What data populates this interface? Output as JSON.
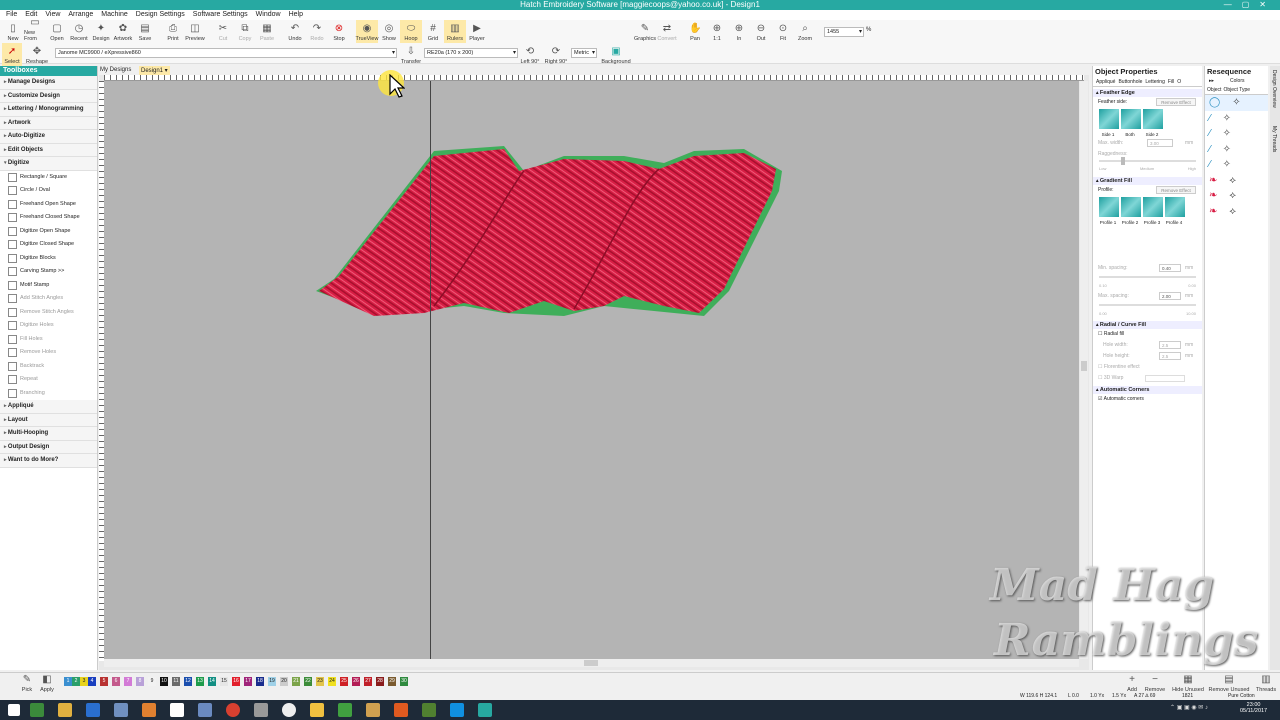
{
  "titlebar": {
    "title": "Hatch Embroidery Software [maggiecoops@yahoo.co.uk] - Design1"
  },
  "menu": [
    "File",
    "Edit",
    "View",
    "Arrange",
    "Machine",
    "Design Settings",
    "Software Settings",
    "Window",
    "Help"
  ],
  "toolbar": [
    "New",
    "New From",
    "Open",
    "Recent",
    "Design",
    "Artwork",
    "Save",
    "Print",
    "Preview",
    "Cut",
    "Copy",
    "Paste",
    "Undo",
    "Redo",
    "Stop",
    "TrueView",
    "Show",
    "Hoop",
    "Grid",
    "Rulers",
    "Player",
    "Graphics",
    "Convert",
    "Pan",
    "1:1",
    "In",
    "Out",
    "Fit",
    "Zoom"
  ],
  "zoom_value": "1455",
  "zoom_unit": "%",
  "toolbar2": {
    "select": "Select",
    "reshape": "Reshape",
    "machine": "Janome MC9900 / eXpressive860",
    "transfer": "Transfer",
    "hoop": "RE20a (170 x 200)",
    "left90": "Left 90°",
    "right90": "Right 90°",
    "units": "Metric",
    "background": "Background"
  },
  "toolboxes": {
    "title": "Toolboxes",
    "sections_top": [
      "Manage Designs",
      "Customize Design",
      "Lettering / Monogramming",
      "Artwork",
      "Auto-Digitize",
      "Edit Objects",
      "Digitize"
    ],
    "digitize_items": [
      "Rectangle / Square",
      "Circle / Oval",
      "Freehand Open Shape",
      "Freehand Closed Shape",
      "Digitize Open Shape",
      "Digitize Closed Shape",
      "Digitize Blocks",
      "Carving Stamp >>",
      "Motif Stamp",
      "Add Stitch Angles",
      "Remove Stitch Angles",
      "Digitize Holes",
      "Fill Holes",
      "Remove Holes",
      "Backtrack",
      "Repeat",
      "Branching"
    ],
    "sections_bottom": [
      "Appliqué",
      "Layout",
      "Multi-Hooping",
      "Output Design",
      "Want to do More?"
    ]
  },
  "tabs": {
    "mydesigns": "My Designs",
    "design1": "Design1"
  },
  "objprops": {
    "title": "Object Properties",
    "tabs": [
      "Appliqué",
      "Buttonhole",
      "Lettering",
      "Fill",
      "O"
    ],
    "feather_edge": "Feather Edge",
    "feather_side": "Feather side:",
    "remove_effect": "Remove Effect",
    "sides": [
      "Side 1",
      "Both",
      "Side 2"
    ],
    "max_width": "Max. width:",
    "max_width_val": "3.00",
    "raggedness": "Raggedness:",
    "rag_labels": [
      "Low",
      "Medium",
      "High"
    ],
    "gradient_fill": "Gradient Fill",
    "profile": "Profile:",
    "profiles": [
      "Profile 1",
      "Profile 2",
      "Profile 3",
      "Profile 4"
    ],
    "min_spacing": "Min. spacing:",
    "min_spacing_val": "0.40",
    "max_spacing": "Max. spacing:",
    "max_spacing_val": "2.00",
    "scale_a": [
      "0.10",
      "0.00"
    ],
    "scale_b": [
      "0.00",
      "10.00"
    ],
    "radial": "Radial / Curve Fill",
    "radial_fill": "Radial fill",
    "hole_width": "Hole width:",
    "hole_width_val": "2.5",
    "hole_height": "Hole height:",
    "hole_height_val": "2.5",
    "florentine": "Florentine effect",
    "warp": "3D Warp",
    "auto_corners": "Automatic Corners",
    "auto_corners_chk": "Automatic corners",
    "unit": "mm"
  },
  "resequence": {
    "title": "Resequence",
    "colors": "Colors",
    "object_type": "Object",
    "object_type2": "Object Type"
  },
  "sidetabs": [
    "Design Overview",
    "My Threads"
  ],
  "colorbar": {
    "pick": "Pick",
    "apply": "Apply",
    "add": "Add",
    "remove": "Remove",
    "hide_unused": "Hide Unused",
    "remove_unused": "Remove Unused",
    "threads": "Threads",
    "chips": [
      {
        "n": "1",
        "c": "#3a8fd0"
      },
      {
        "n": "2",
        "c": "#2a9f6a"
      },
      {
        "n": "3",
        "c": "#e8d21c"
      },
      {
        "n": "4",
        "c": "#1a3fbf"
      },
      {
        "n": "5",
        "c": "#b83232"
      },
      {
        "n": "6",
        "c": "#c45a8c"
      },
      {
        "n": "7",
        "c": "#d37bd6"
      },
      {
        "n": "8",
        "c": "#b9a1d8"
      },
      {
        "n": "9",
        "c": "#f2f2f2"
      },
      {
        "n": "10",
        "c": "#111111"
      },
      {
        "n": "11",
        "c": "#6b6b6b"
      },
      {
        "n": "12",
        "c": "#1b4fae"
      },
      {
        "n": "13",
        "c": "#1f9c4c"
      },
      {
        "n": "14",
        "c": "#138f83"
      },
      {
        "n": "15",
        "c": "#e6e6e6"
      },
      {
        "n": "16",
        "c": "#e21f2c"
      },
      {
        "n": "17",
        "c": "#a0247a"
      },
      {
        "n": "18",
        "c": "#1a2d8e"
      },
      {
        "n": "19",
        "c": "#9fd1e8"
      },
      {
        "n": "20",
        "c": "#cccccc"
      },
      {
        "n": "21",
        "c": "#7ca44a"
      },
      {
        "n": "22",
        "c": "#3d8d3a"
      },
      {
        "n": "23",
        "c": "#e2c54b"
      },
      {
        "n": "24",
        "c": "#f0e020"
      },
      {
        "n": "25",
        "c": "#cf2025"
      },
      {
        "n": "26",
        "c": "#b31d55"
      },
      {
        "n": "27",
        "c": "#c0202a"
      },
      {
        "n": "28",
        "c": "#8a1c1c"
      },
      {
        "n": "29",
        "c": "#7a5a2e"
      },
      {
        "n": "30",
        "c": "#2e8a3e"
      }
    ]
  },
  "status": {
    "coords": "W 119.6 H 124.1",
    "length": "L 0.0",
    "stitches": "1.0 Yx",
    "extra": "1.5 Yx",
    "angle": "A 27 ∆ 69",
    "count": "1821",
    "thread": "Pure Cotton"
  },
  "clock": {
    "time": "23:00",
    "date": "05/11/2017"
  },
  "watermark": {
    "line1": "Mad Hag",
    "line2": "Ramblings"
  },
  "colors": {
    "accent": "#27a9a2",
    "canvas": "#b4b4b4",
    "red": "#d81e45",
    "green": "#3fae5a"
  }
}
